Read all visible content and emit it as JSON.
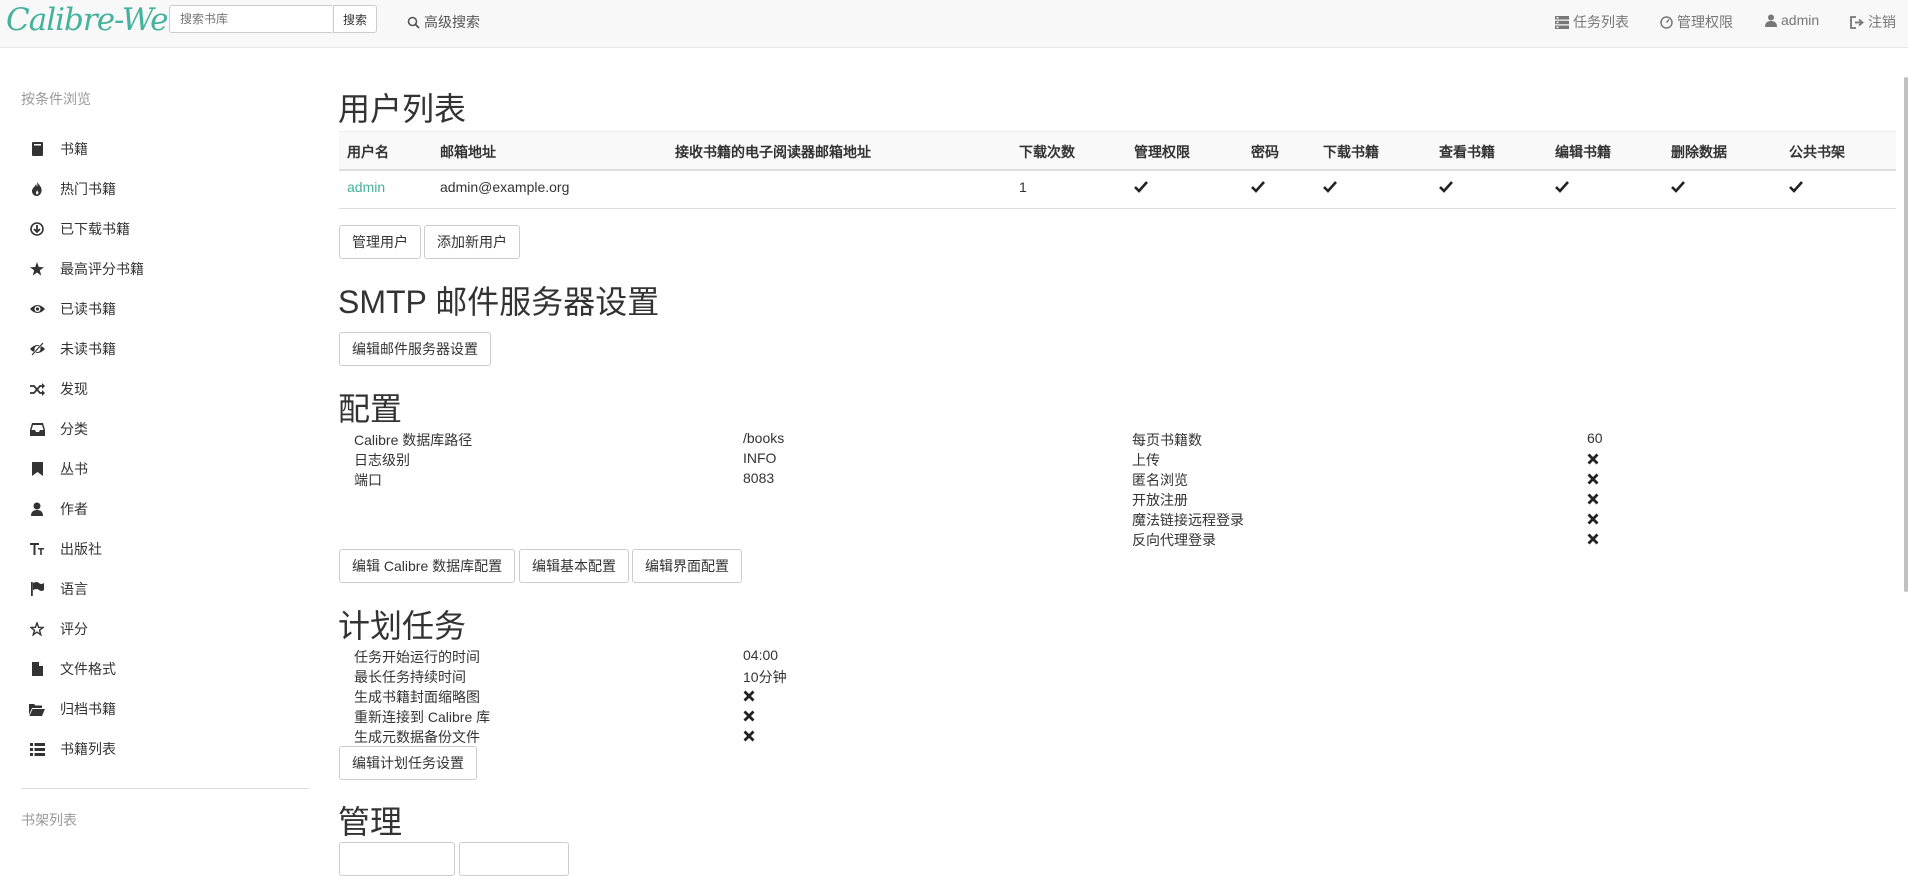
{
  "navbar": {
    "brand": "Calibre-Web",
    "search_placeholder": "搜索书库",
    "search_button": "搜索",
    "advanced_search": "高级搜索",
    "tasks": "任务列表",
    "admin_panel": "管理权限",
    "user": "admin",
    "logout": "注销"
  },
  "sidebar": {
    "header": "按条件浏览",
    "items": [
      {
        "label": "书籍",
        "icon": "book-icon"
      },
      {
        "label": "热门书籍",
        "icon": "fire-icon"
      },
      {
        "label": "已下载书籍",
        "icon": "download-icon"
      },
      {
        "label": "最高评分书籍",
        "icon": "star-icon"
      },
      {
        "label": "已读书籍",
        "icon": "eye-icon"
      },
      {
        "label": "未读书籍",
        "icon": "eye-slash-icon"
      },
      {
        "label": "发现",
        "icon": "random-icon"
      },
      {
        "label": "分类",
        "icon": "inbox-icon"
      },
      {
        "label": "丛书",
        "icon": "bookmark-icon"
      },
      {
        "label": "作者",
        "icon": "user-icon"
      },
      {
        "label": "出版社",
        "icon": "text-size-icon"
      },
      {
        "label": "语言",
        "icon": "flag-icon"
      },
      {
        "label": "评分",
        "icon": "star-empty-icon"
      },
      {
        "label": "文件格式",
        "icon": "file-icon"
      },
      {
        "label": "归档书籍",
        "icon": "folder-open-icon"
      },
      {
        "label": "书籍列表",
        "icon": "list-icon"
      }
    ],
    "shelves_header": "书架列表"
  },
  "users": {
    "title": "用户列表",
    "columns": [
      "用户名",
      "邮箱地址",
      "接收书籍的电子阅读器邮箱地址",
      "下载次数",
      "管理权限",
      "密码",
      "下载书籍",
      "查看书籍",
      "编辑书籍",
      "删除数据",
      "公共书架"
    ],
    "rows": [
      {
        "username": "admin",
        "email": "admin@example.org",
        "kindle": "",
        "downloads": "1",
        "admin": "✔",
        "password": "✔",
        "download": "✔",
        "view": "✔",
        "edit": "✔",
        "delete": "✔",
        "public_shelf": "✔"
      }
    ],
    "manage_button": "管理用户",
    "add_button": "添加新用户"
  },
  "smtp": {
    "title": "SMTP 邮件服务器设置",
    "edit_button": "编辑邮件服务器设置"
  },
  "config": {
    "title": "配置",
    "left": [
      {
        "label": "Calibre 数据库路径",
        "value": "/books"
      },
      {
        "label": "日志级别",
        "value": "INFO"
      },
      {
        "label": "端口",
        "value": "8083"
      }
    ],
    "right": [
      {
        "label": "每页书籍数",
        "value": "60"
      },
      {
        "label": "上传",
        "value": "✖"
      },
      {
        "label": "匿名浏览",
        "value": "✖"
      },
      {
        "label": "开放注册",
        "value": "✖"
      },
      {
        "label": "魔法链接远程登录",
        "value": "✖"
      },
      {
        "label": "反向代理登录",
        "value": "✖"
      }
    ],
    "edit_db_button": "编辑 Calibre 数据库配置",
    "edit_basic_button": "编辑基本配置",
    "edit_ui_button": "编辑界面配置"
  },
  "scheduled": {
    "title": "计划任务",
    "items": [
      {
        "label": "任务开始运行的时间",
        "value": "04:00"
      },
      {
        "label": "最长任务持续时间",
        "value": "10分钟"
      },
      {
        "label": "生成书籍封面缩略图",
        "value": "✖"
      },
      {
        "label": "重新连接到 Calibre 库",
        "value": "✖"
      },
      {
        "label": "生成元数据备份文件",
        "value": "✖"
      }
    ],
    "edit_button": "编辑计划任务设置"
  },
  "admin": {
    "title": "管理"
  }
}
